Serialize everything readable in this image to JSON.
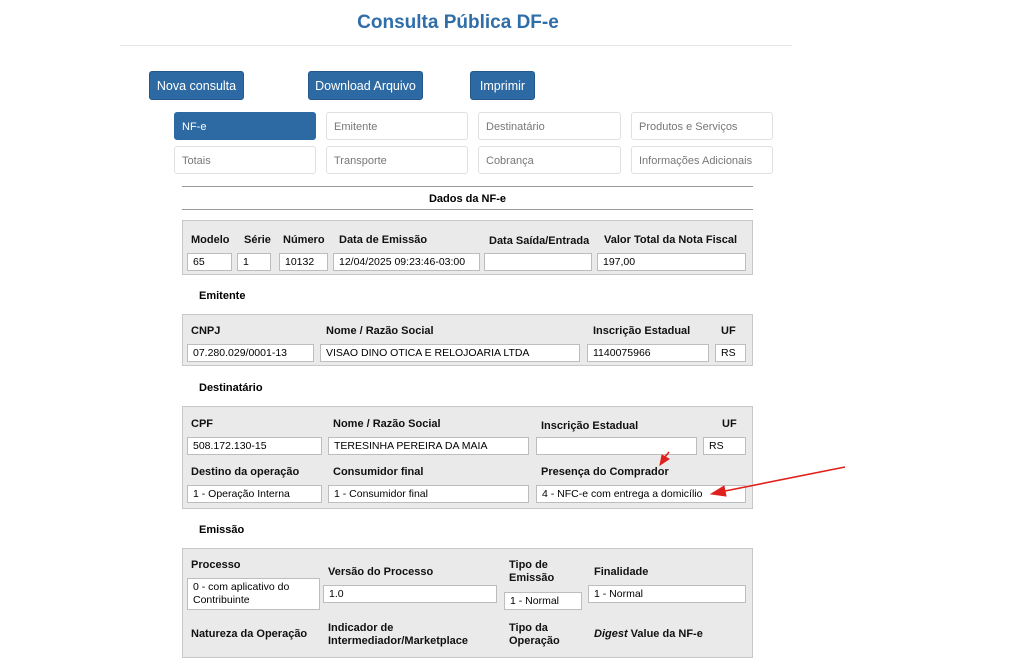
{
  "header": {
    "title": "Consulta Pública DF-e"
  },
  "toolbar": {
    "new_query": "Nova consulta",
    "download": "Download Arquivo",
    "print": "Imprimir"
  },
  "tabs": [
    {
      "label": "NF-e"
    },
    {
      "label": "Emitente"
    },
    {
      "label": "Destinatário"
    },
    {
      "label": "Produtos e Serviços"
    },
    {
      "label": "Totais"
    },
    {
      "label": "Transporte"
    },
    {
      "label": "Cobrança"
    },
    {
      "label": "Informações Adicionais"
    }
  ],
  "dados": {
    "title": "Dados da NF-e",
    "labels": {
      "modelo": "Modelo",
      "serie": "Série",
      "numero": "Número",
      "emissao": "Data de Emissão",
      "saida": "Data Saída/Entrada",
      "valor": "Valor Total da Nota Fiscal"
    },
    "values": {
      "modelo": "65",
      "serie": "1",
      "numero": "10132",
      "emissao": "12/04/2025 09:23:46-03:00",
      "saida": "",
      "valor": "197,00"
    }
  },
  "emitente": {
    "title": "Emitente",
    "labels": {
      "cnpj": "CNPJ",
      "nome": "Nome / Razão Social",
      "ie": "Inscrição Estadual",
      "uf": "UF"
    },
    "values": {
      "cnpj": "07.280.029/0001-13",
      "nome": "VISAO DINO OTICA E RELOJOARIA LTDA",
      "ie": "1140075966",
      "uf": "RS"
    }
  },
  "destinatario": {
    "title": "Destinatário",
    "labels": {
      "cpf": "CPF",
      "nome": "Nome / Razão Social",
      "ie": "Inscrição Estadual",
      "uf": "UF",
      "destino": "Destino da operação",
      "consumidor": "Consumidor final",
      "presenca": "Presença do Comprador"
    },
    "values": {
      "cpf": "508.172.130-15",
      "nome": "TERESINHA PEREIRA DA MAIA",
      "ie": "",
      "uf": "RS",
      "destino": "1 - Operação Interna",
      "consumidor": "1 - Consumidor final",
      "presenca": "4 - NFC-e com entrega a domicílio"
    }
  },
  "emissao": {
    "title": "Emissão",
    "labels": {
      "processo": "Processo",
      "versao": "Versão do Processo",
      "tipo_emissao": "Tipo de Emissão",
      "finalidade": "Finalidade",
      "natureza": "Natureza da Operação",
      "intermediador": "Indicador de Intermediador/Marketplace",
      "tipo_operacao": "Tipo da Operação",
      "digest_em": "Digest",
      "digest_rest": " Value da NF-e"
    },
    "values": {
      "processo": "0 - com aplicativo do Contribuinte",
      "versao": "1.0",
      "tipo_emissao": "1 - Normal",
      "finalidade": "1 - Normal"
    }
  },
  "annotation_color": "#e0201c"
}
